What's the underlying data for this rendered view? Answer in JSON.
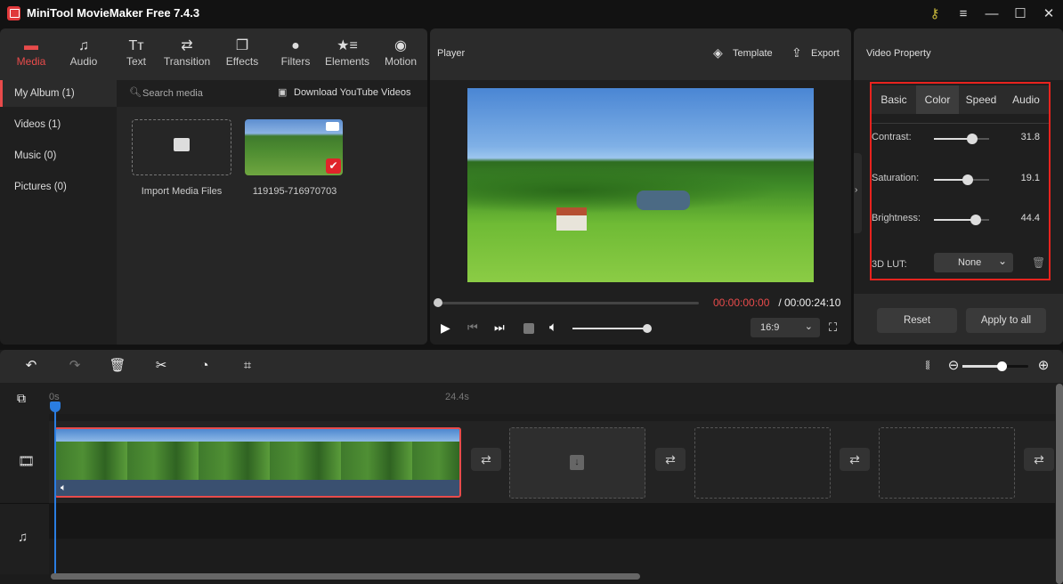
{
  "window": {
    "title": "MiniTool MovieMaker Free 7.4.3",
    "controls": [
      "key-icon",
      "menu-icon",
      "minimize-icon",
      "maximize-icon",
      "close-icon"
    ]
  },
  "media_toolbar": {
    "tabs": [
      {
        "label": "Media",
        "icon": "folder-icon",
        "active": true
      },
      {
        "label": "Audio",
        "icon": "music-note-icon"
      },
      {
        "label": "Text",
        "icon": "text-icon"
      },
      {
        "label": "Transition",
        "icon": "swap-arrows-icon"
      },
      {
        "label": "Effects",
        "icon": "layers-icon"
      },
      {
        "label": "Filters",
        "icon": "filters-icon"
      },
      {
        "label": "Elements",
        "icon": "star-list-icon"
      },
      {
        "label": "Motion",
        "icon": "motion-icon"
      }
    ]
  },
  "album": {
    "items": [
      {
        "label": "My Album (1)",
        "active": true
      },
      {
        "label": "Videos (1)"
      },
      {
        "label": "Music (0)"
      },
      {
        "label": "Pictures (0)"
      }
    ]
  },
  "media": {
    "search_placeholder": "Search media",
    "download_label": "Download YouTube Videos",
    "import_label": "Import Media Files",
    "clip_name": "119195-716970703"
  },
  "player": {
    "title": "Player",
    "template_label": "Template",
    "export_label": "Export",
    "current_time": "00:00:00:00",
    "separator": " / ",
    "total_time": "00:00:24:10",
    "progress": 0,
    "volume": 1.0,
    "aspect_ratio": "16:9"
  },
  "property": {
    "title": "Video Property",
    "tabs": [
      {
        "label": "Basic"
      },
      {
        "label": "Color",
        "active": true
      },
      {
        "label": "Speed"
      },
      {
        "label": "Audio"
      }
    ],
    "sliders": [
      {
        "label": "Contrast:",
        "value": "31.8",
        "fraction": 0.7
      },
      {
        "label": "Saturation:",
        "value": "19.1",
        "fraction": 0.62
      },
      {
        "label": "Brightness:",
        "value": "44.4",
        "fraction": 0.75
      }
    ],
    "lut_label": "3D LUT:",
    "lut_value": "None",
    "reset_label": "Reset",
    "apply_all_label": "Apply to all"
  },
  "timeline": {
    "ruler_start": "0s",
    "ruler_end": "24.4s",
    "zoom_level": 0.6
  },
  "colors": {
    "accent_red": "#e84b4b",
    "playhead_blue": "#2a7de1",
    "highlight_box": "#e8231e",
    "time_current": "#e84b4b"
  }
}
